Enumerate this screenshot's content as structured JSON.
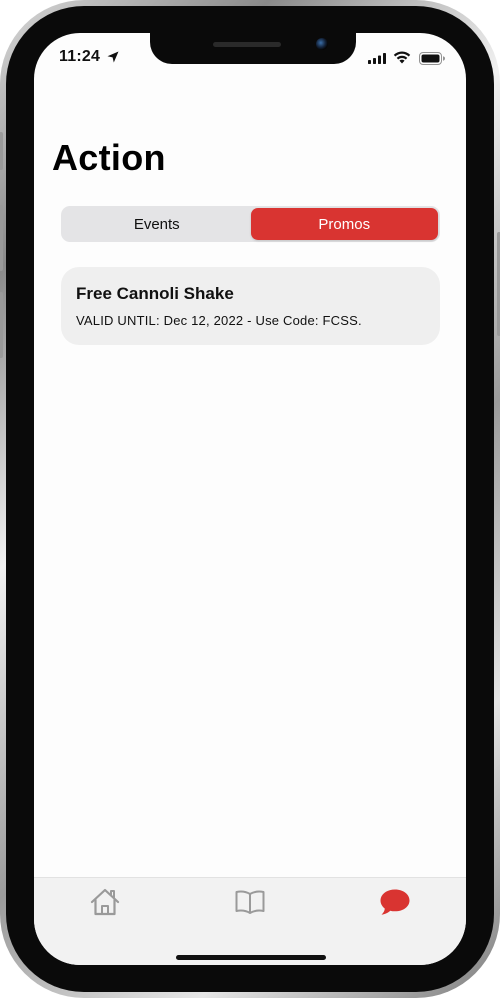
{
  "status_bar": {
    "time": "11:24",
    "icons": [
      "location-arrow-icon",
      "cellular-signal-icon",
      "wifi-icon",
      "battery-icon"
    ]
  },
  "page": {
    "title": "Action"
  },
  "segmented_control": {
    "segments": [
      {
        "label": "Events",
        "active": false
      },
      {
        "label": "Promos",
        "active": true
      }
    ],
    "active_color": "#d93431"
  },
  "promos": [
    {
      "title": "Free Cannoli Shake",
      "detail": "VALID UNTIL: Dec 12, 2022 - Use Code: FCSS."
    }
  ],
  "tab_bar": {
    "tabs": [
      {
        "icon": "home-icon",
        "active": false
      },
      {
        "icon": "book-icon",
        "active": false
      },
      {
        "icon": "chat-bubble-icon",
        "active": true
      }
    ],
    "active_color": "#d93431",
    "inactive_color": "#9a9a9a"
  }
}
